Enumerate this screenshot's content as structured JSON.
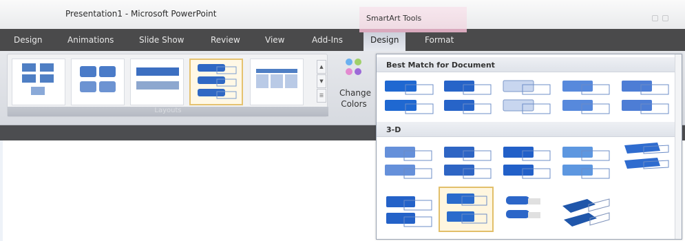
{
  "window": {
    "title": "Presentation1 - Microsoft PowerPoint",
    "contextual_group": "SmartArt Tools"
  },
  "tabs": [
    {
      "label": "Design"
    },
    {
      "label": "Animations"
    },
    {
      "label": "Slide Show"
    },
    {
      "label": "Review"
    },
    {
      "label": "View"
    },
    {
      "label": "Add-Ins"
    },
    {
      "label": "Design",
      "active": true
    },
    {
      "label": "Format"
    }
  ],
  "ribbon": {
    "layouts_group_label": "Layouts",
    "change_colors_label_1": "Change",
    "change_colors_label_2": "Colors",
    "selected_layout_index": 3
  },
  "dropdown": {
    "section_best_match": "Best Match for Document",
    "section_3d": "3-D",
    "selected_style": "3-D row 2, item 2"
  },
  "colors": {
    "accent_blue": "#2f6fd6",
    "tab_bar": "#4a4a4b",
    "selected_border": "#e2bf6a"
  }
}
